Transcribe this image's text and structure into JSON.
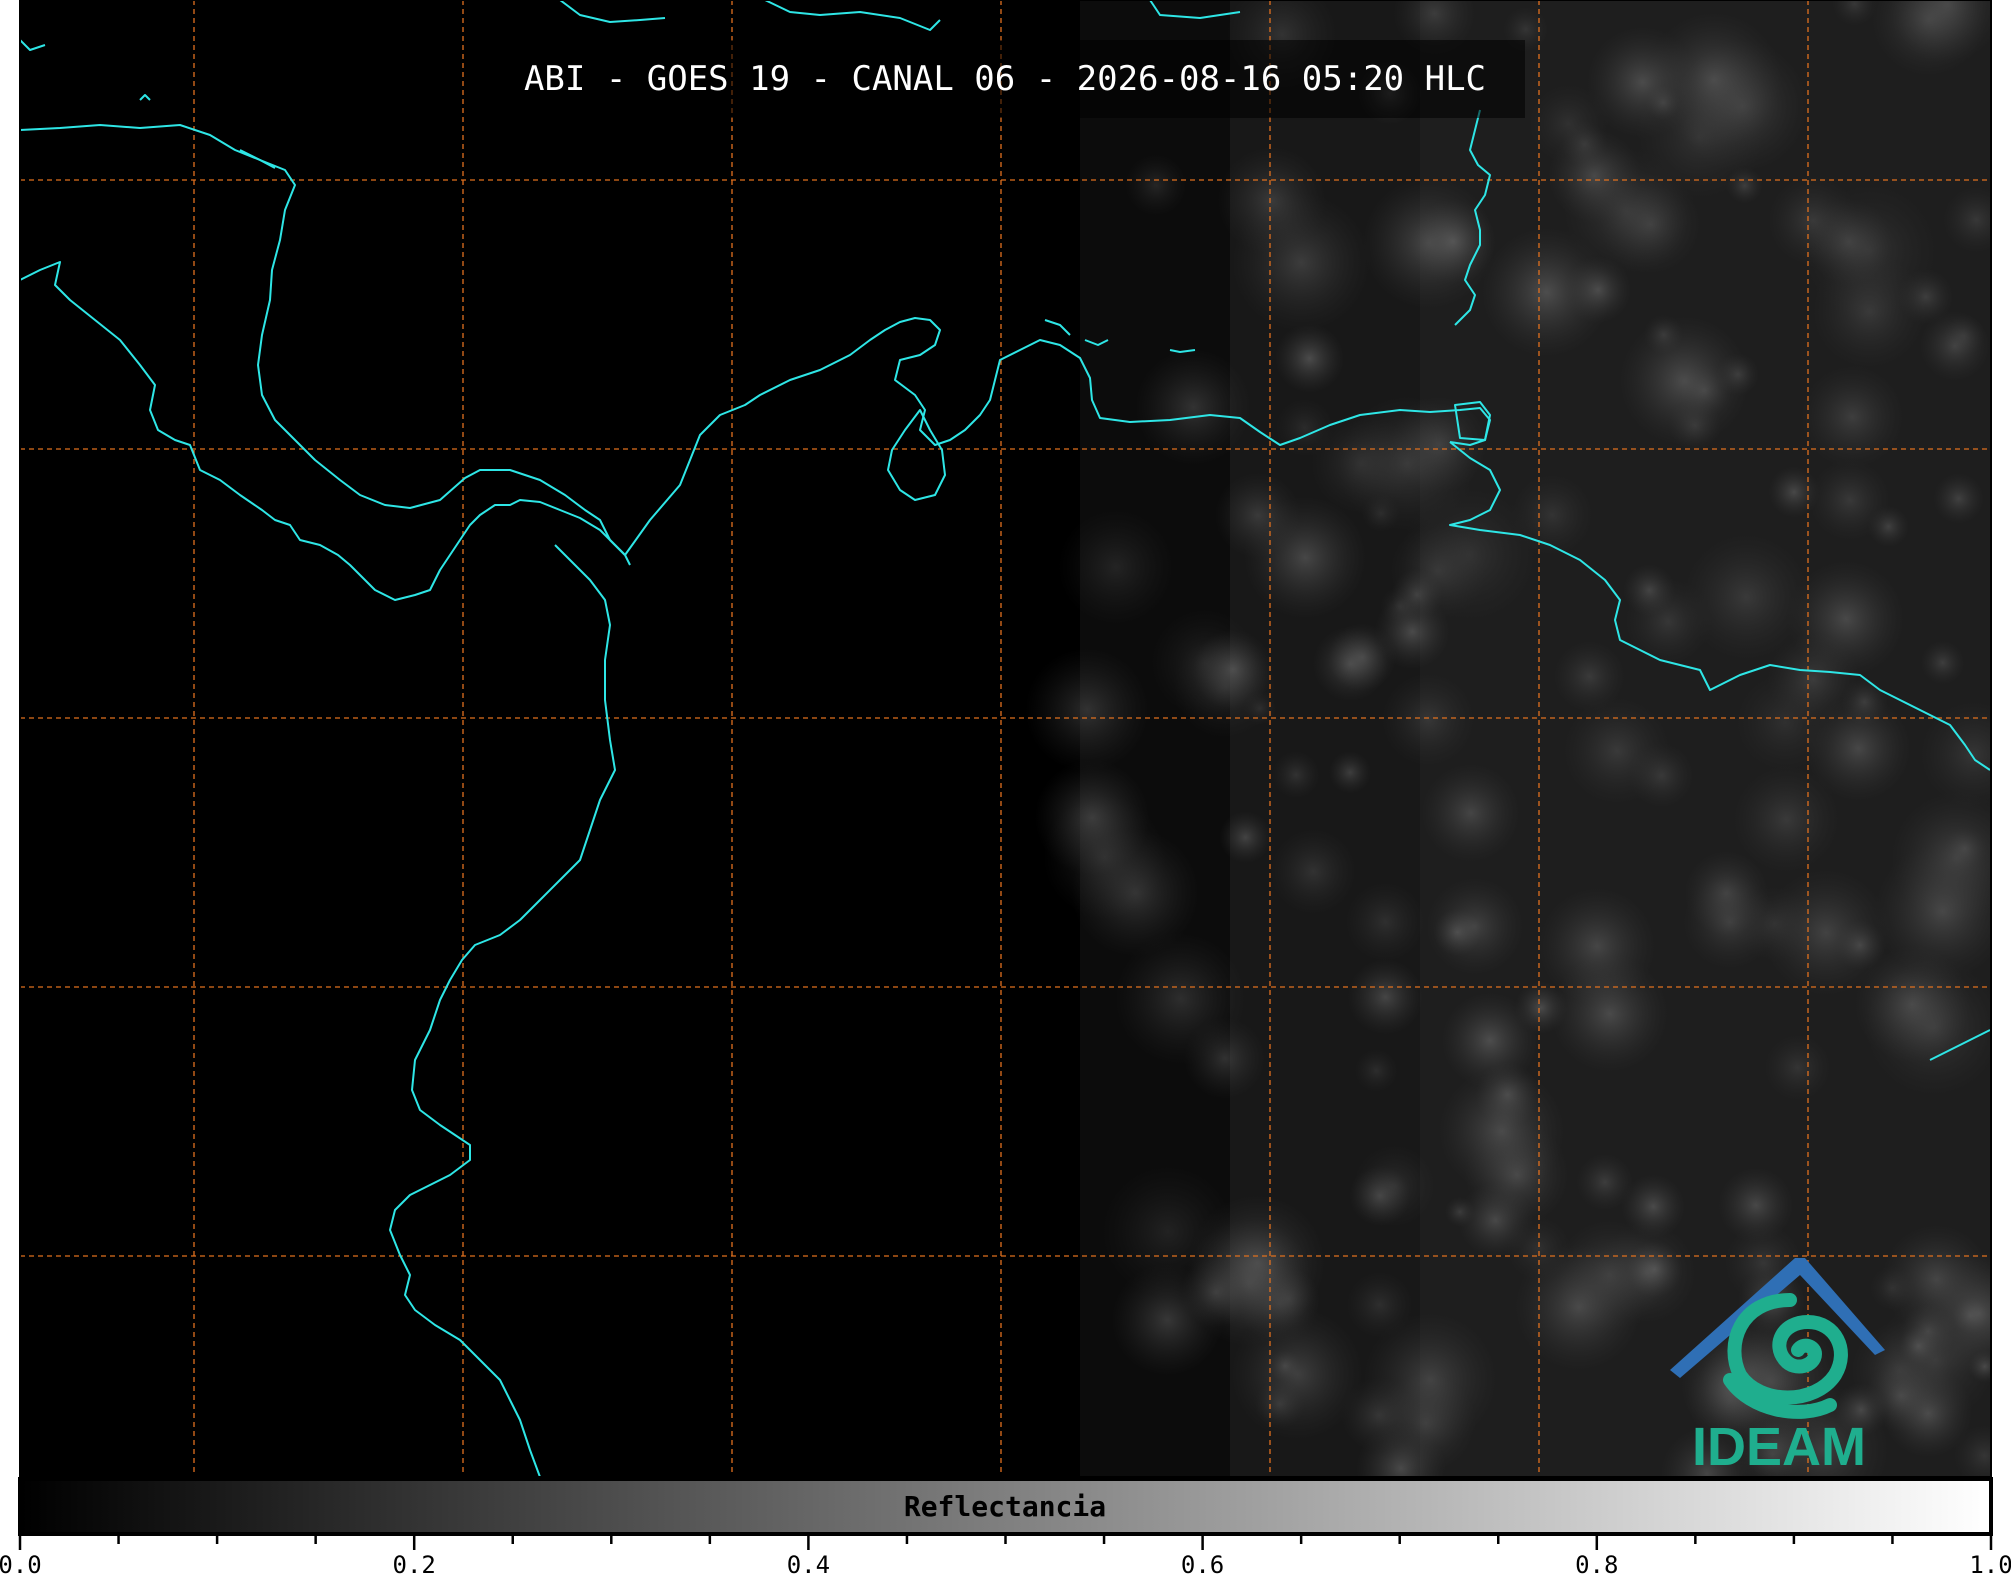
{
  "map": {
    "title": "ABI - GOES 19 - CANAL 06 - 2026-08-16 05:20 HLC",
    "background_color": "#000000",
    "coastline_color": "#2ee6e6",
    "gridline_color": "#e0701e",
    "cloud_color": "#5a5a5a"
  },
  "logo": {
    "text": "IDEAM",
    "mountain_color": "#2f6fb5",
    "swirl_color": "#1fae8e",
    "text_color": "#1fae8e"
  },
  "colorbar": {
    "label": "Reflectancia",
    "range": [
      0.0,
      1.0
    ],
    "tick_labels": [
      "0.0",
      "0.2",
      "0.4",
      "0.6",
      "0.8",
      "1.0"
    ],
    "start_color": "#000000",
    "end_color": "#ffffff"
  }
}
